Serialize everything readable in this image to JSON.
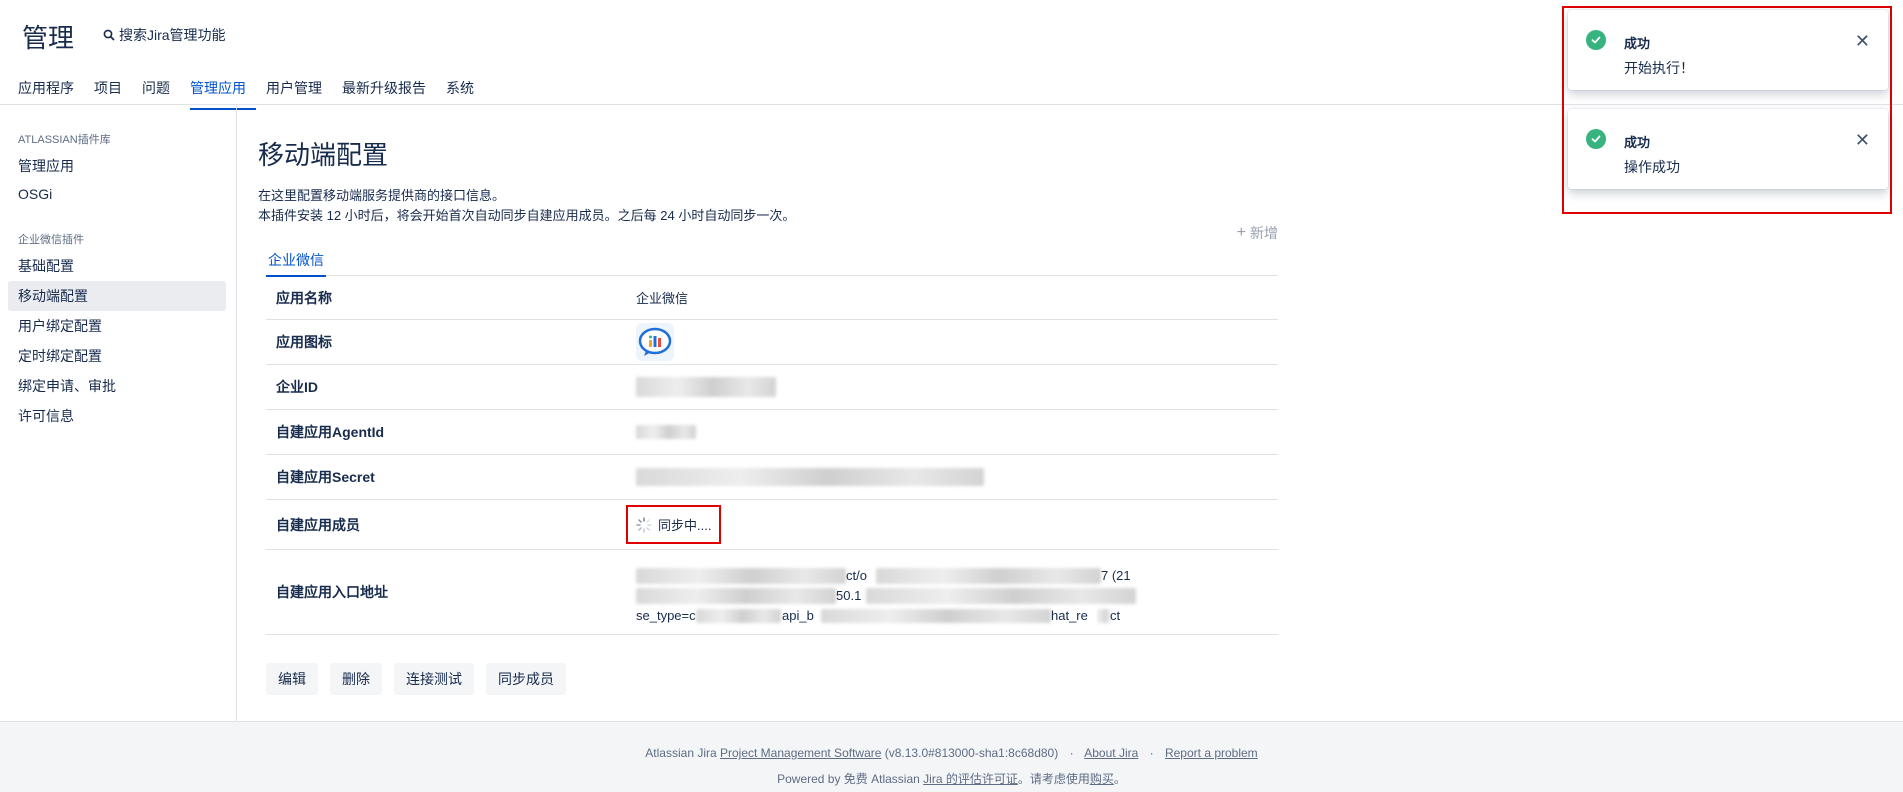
{
  "header": {
    "title": "管理",
    "search_label": "搜索Jira管理功能"
  },
  "nav": {
    "tabs": [
      "应用程序",
      "项目",
      "问题",
      "管理应用",
      "用户管理",
      "最新升级报告",
      "系统"
    ]
  },
  "sidebar": {
    "section1_title": "ATLASSIAN插件库",
    "section1_items": [
      "管理应用",
      "OSGi"
    ],
    "section2_title": "企业微信插件",
    "section2_items": [
      "基础配置",
      "移动端配置",
      "用户绑定配置",
      "定时绑定配置",
      "绑定申请、审批",
      "许可信息"
    ]
  },
  "main": {
    "title": "移动端配置",
    "desc1": "在这里配置移动端服务提供商的接口信息。",
    "desc2": "本插件安装 12 小时后，将会开始首次自动同步自建应用成员。之后每 24 小时自动同步一次。",
    "add_label": "新增",
    "tab_label": "企业微信",
    "rows": {
      "app_name_label": "应用名称",
      "app_name_value": "企业微信",
      "app_icon_label": "应用图标",
      "corp_id_label": "企业ID",
      "agent_id_label": "自建应用AgentId",
      "secret_label": "自建应用Secret",
      "members_label": "自建应用成员",
      "members_value": "同步中....",
      "entry_label": "自建应用入口地址",
      "entry_line1_a": "ct/o",
      "entry_line1_b": "7 (21",
      "entry_line2": "50.1",
      "entry_line3_a": "se_type=c",
      "entry_line3_b": "api_b",
      "entry_line3_c": "hat_re",
      "entry_line3_d": "ct"
    },
    "buttons": [
      "编辑",
      "删除",
      "连接测试",
      "同步成员"
    ]
  },
  "footer": {
    "line1_prefix": "Atlassian Jira ",
    "line1_link": "Project Management Software",
    "line1_version": " (v8.13.0#813000-sha1:8c68d80)",
    "about": "About Jira",
    "report": "Report a problem",
    "line2_prefix": "Powered by 免费 Atlassian ",
    "line2_link": "Jira 的评估许可证",
    "line2_mid": "。请考虑使用",
    "line2_buy": "购买",
    "line2_end": "。"
  },
  "toasts": [
    {
      "title": "成功",
      "message": "开始执行！"
    },
    {
      "title": "成功",
      "message": "操作成功"
    }
  ],
  "colors": {
    "accent": "#0052cc",
    "success": "#36b37e",
    "highlight": "#e00000"
  }
}
